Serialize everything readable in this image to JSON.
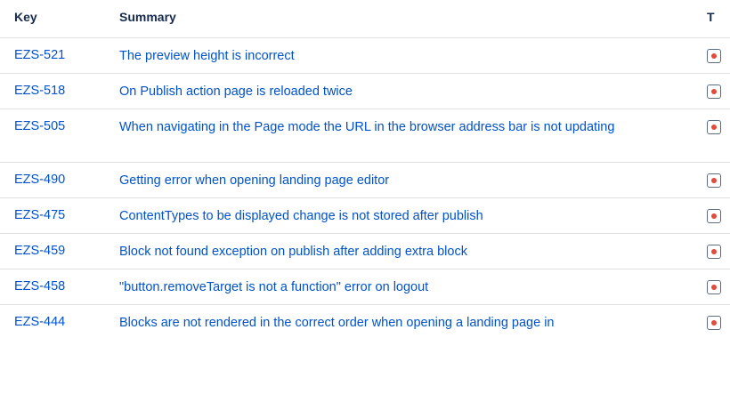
{
  "table": {
    "headers": {
      "key": "Key",
      "summary": "Summary",
      "type": "T"
    },
    "rows": [
      {
        "key": "EZS-521",
        "summary": "The preview height is incorrect",
        "type_icon": "bug-icon"
      },
      {
        "key": "EZS-518",
        "summary": "On Publish action page is reloaded twice",
        "type_icon": "bug-icon"
      },
      {
        "key": "EZS-505",
        "summary": "When navigating in the Page mode the URL in the browser address bar is not updating",
        "type_icon": "bug-icon"
      },
      {
        "key": "EZS-490",
        "summary": "Getting error when opening landing page editor",
        "type_icon": "bug-icon"
      },
      {
        "key": "EZS-475",
        "summary": "ContentTypes to be displayed change is not stored after publish",
        "type_icon": "bug-icon"
      },
      {
        "key": "EZS-459",
        "summary": "Block not found exception on publish after adding extra block",
        "type_icon": "bug-icon"
      },
      {
        "key": "EZS-458",
        "summary": "\"button.removeTarget is not a function\" error on logout",
        "type_icon": "bug-icon"
      },
      {
        "key": "EZS-444",
        "summary": "Blocks are not rendered in the correct order when opening a landing page in",
        "type_icon": "bug-icon"
      }
    ]
  },
  "colors": {
    "link": "#0052cc",
    "header_text": "#172b4d",
    "divider": "#dfe1e6",
    "bug_red": "#e5493a"
  }
}
